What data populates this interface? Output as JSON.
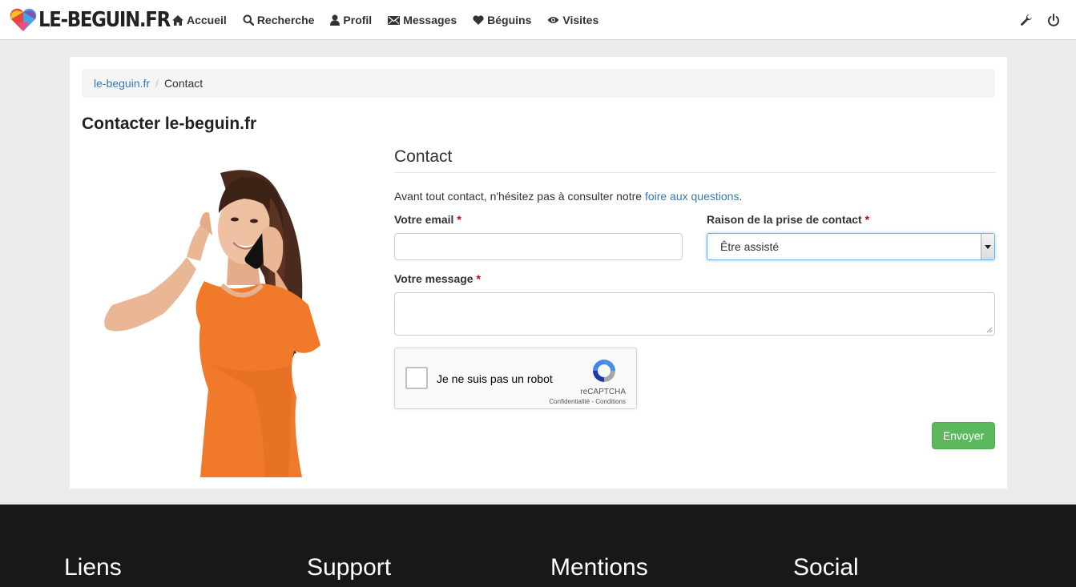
{
  "brand": {
    "logo_text": "LE-BEGUIN.FR"
  },
  "nav": {
    "items": [
      {
        "label": "Accueil",
        "icon": "home-icon"
      },
      {
        "label": "Recherche",
        "icon": "search-icon"
      },
      {
        "label": "Profil",
        "icon": "user-icon"
      },
      {
        "label": "Messages",
        "icon": "envelope-icon"
      },
      {
        "label": "Béguins",
        "icon": "heart-icon"
      },
      {
        "label": "Visites",
        "icon": "eye-icon"
      }
    ],
    "right_icons": [
      "wrench-icon",
      "power-icon"
    ]
  },
  "breadcrumb": {
    "home": "le-beguin.fr",
    "separator": "/",
    "current": "Contact"
  },
  "page": {
    "title": "Contacter le-beguin.fr"
  },
  "form": {
    "legend": "Contact",
    "intro_before": "Avant tout contact, n'hésitez pas à consulter notre ",
    "intro_link": "foire aux questions",
    "intro_after": ".",
    "email_label": "Votre email",
    "email_value": "",
    "reason_label": "Raison de la prise de contact",
    "reason_selected": "Être assisté",
    "message_label": "Votre message",
    "message_value": "",
    "required_mark": "*",
    "submit_label": "Envoyer"
  },
  "captcha": {
    "text": "Je ne suis pas un robot",
    "brand": "reCAPTCHA",
    "terms": "Confidentialité - Conditions",
    "checked": false
  },
  "footer": {
    "columns": [
      "Liens",
      "Support",
      "Mentions",
      "Social"
    ]
  },
  "colors": {
    "link": "#337ab7",
    "submit": "#5cb85c",
    "footer_bg": "#181818",
    "required": "#cc0000",
    "shirt": "#f07a2a"
  }
}
